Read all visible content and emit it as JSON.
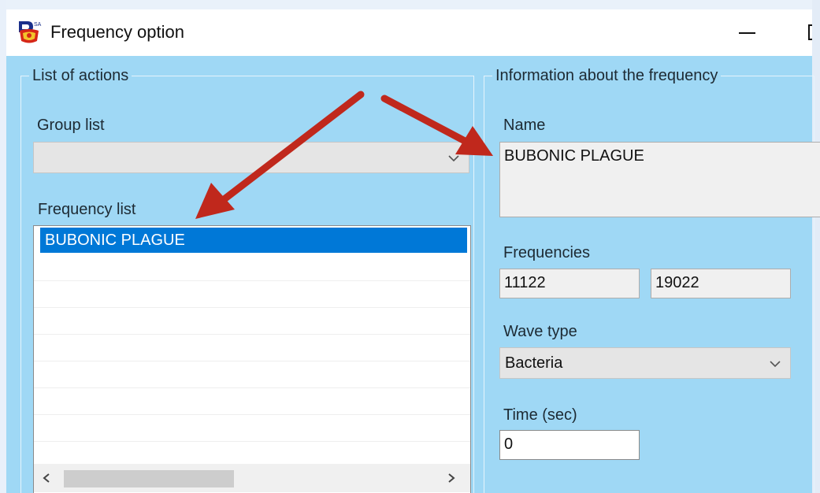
{
  "window": {
    "title": "Frequency option",
    "icon": "app-logo-icon"
  },
  "actions_group": {
    "legend": "List of actions",
    "group_list_label": "Group list",
    "group_list_value": "",
    "frequency_list_label": "Frequency list",
    "frequency_items": [
      "BUBONIC PLAGUE"
    ]
  },
  "info_group": {
    "legend": "Information about the frequency",
    "name_label": "Name",
    "name_value": "BUBONIC PLAGUE",
    "frequencies_label": "Frequencies",
    "frequency_1": "11122",
    "frequency_2": "19022",
    "wave_type_label": "Wave type",
    "wave_type_value": "Bacteria",
    "time_label": "Time (sec)",
    "time_value": "0"
  },
  "colors": {
    "window_bg": "#9fd8f5",
    "selection": "#0078d7",
    "annotation_arrow": "#c0281c"
  }
}
